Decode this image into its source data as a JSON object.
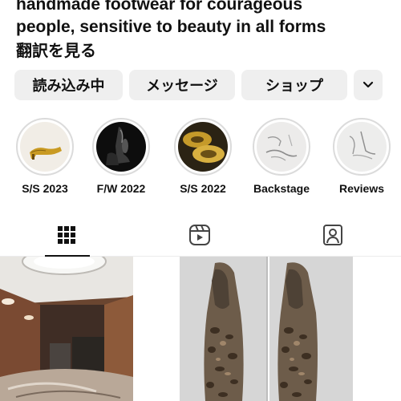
{
  "profile": {
    "bio_lines": [
      "handmade footwear for courageous",
      "people, sensitive to beauty in all forms"
    ],
    "translate_link": "翻訳を見る"
  },
  "actions": {
    "follow_label": "読み込み中",
    "message_label": "メッセージ",
    "shop_label": "ショップ",
    "more_icon": "chevron-down-icon"
  },
  "highlights": [
    {
      "label": "S/S 2023"
    },
    {
      "label": "F/W 2022"
    },
    {
      "label": "S/S 2022"
    },
    {
      "label": "Backstage"
    },
    {
      "label": "Reviews"
    }
  ],
  "tabs": [
    {
      "name": "posts",
      "icon": "grid-icon",
      "active": true
    },
    {
      "name": "reels",
      "icon": "reels-icon",
      "active": false
    },
    {
      "name": "tagged",
      "icon": "tagged-icon",
      "active": false
    }
  ],
  "posts": [
    {
      "content": "store interior photo"
    },
    {
      "content": "pair of leopard print shoes photo"
    },
    {
      "content": "empty tile"
    }
  ]
}
